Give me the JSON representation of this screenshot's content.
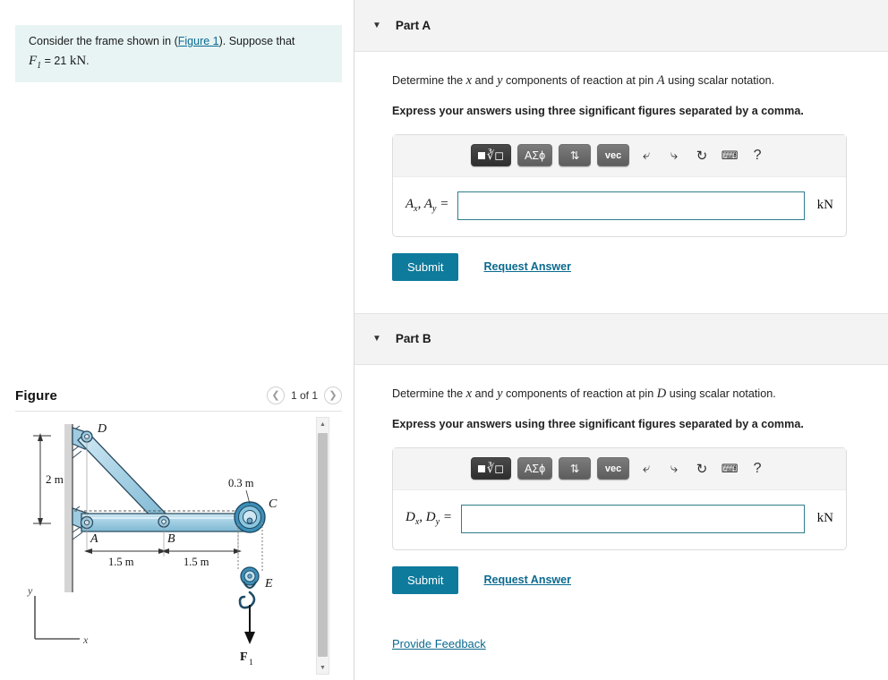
{
  "problem": {
    "text_before_link": "Consider the frame shown in (",
    "figure_link": "Figure 1",
    "text_after_link": "). Suppose that",
    "given_symbol": "F",
    "given_sub": "1",
    "given_eq": "= 21",
    "given_unit": "kN",
    "given_period": "."
  },
  "figure": {
    "title": "Figure",
    "pager_label": "1 of 1",
    "prev_icon": "chevron-left-icon",
    "next_icon": "chevron-right-icon",
    "scroll_up_icon": "triangle-up-icon",
    "scroll_down_icon": "triangle-down-icon",
    "labels": {
      "D": "D",
      "A": "A",
      "B": "B",
      "C": "C",
      "E": "E",
      "force": "F",
      "force_sub": "1",
      "dim_vertical": "2 m",
      "dim_left": "1.5 m",
      "dim_right": "1.5  m",
      "dim_pulley": "0.3 m",
      "axis_y": "y",
      "axis_x": "x"
    },
    "colors": {
      "member_fill": "#a8d4e6",
      "member_stroke": "#2b4a5e",
      "pulley_fill": "#3d8fb8",
      "wall_fill": "#cfcfcf"
    }
  },
  "parts": [
    {
      "id": "A",
      "title": "Part A",
      "caret_icon": "caret-down-icon",
      "question": {
        "pre": "Determine the ",
        "var_x": "x",
        "mid": " and ",
        "var_y": "y",
        "post": " components of reaction at pin ",
        "pin": "A",
        "tail": " using scalar notation."
      },
      "instruction": "Express your answers using three significant figures separated by a comma.",
      "answer": {
        "label_main1": "A",
        "label_sub1": "x",
        "label_sep": ", ",
        "label_main2": "A",
        "label_sub2": "y",
        "label_eq": " =",
        "value": "",
        "placeholder": "",
        "unit": "kN"
      },
      "submit_label": "Submit",
      "request_label": "Request Answer"
    },
    {
      "id": "B",
      "title": "Part B",
      "caret_icon": "caret-down-icon",
      "question": {
        "pre": "Determine the ",
        "var_x": "x",
        "mid": " and ",
        "var_y": "y",
        "post": " components of reaction at pin ",
        "pin": "D",
        "tail": " using scalar notation."
      },
      "instruction": "Express your answers using three significant figures separated by a comma.",
      "answer": {
        "label_main1": "D",
        "label_sub1": "x",
        "label_sep": ", ",
        "label_main2": "D",
        "label_sub2": "y",
        "label_eq": " =",
        "value": "",
        "placeholder": "",
        "unit": "kN"
      },
      "submit_label": "Submit",
      "request_label": "Request Answer"
    }
  ],
  "toolbar": {
    "template_btn": "template-math-button",
    "template_label": "√",
    "greek_label": "ΑΣϕ",
    "updown_label": "⇅",
    "vec_label": "vec",
    "undo_icon": "undo-arrow-icon",
    "redo_icon": "redo-arrow-icon",
    "reset_icon": "reset-circular-arrow-icon",
    "keyboard_icon": "keyboard-icon",
    "help_icon": "question-mark-icon"
  },
  "footer": {
    "feedback_label": "Provide Feedback"
  },
  "accent_color": "#0e7a9c",
  "link_color": "#0b6a8f"
}
